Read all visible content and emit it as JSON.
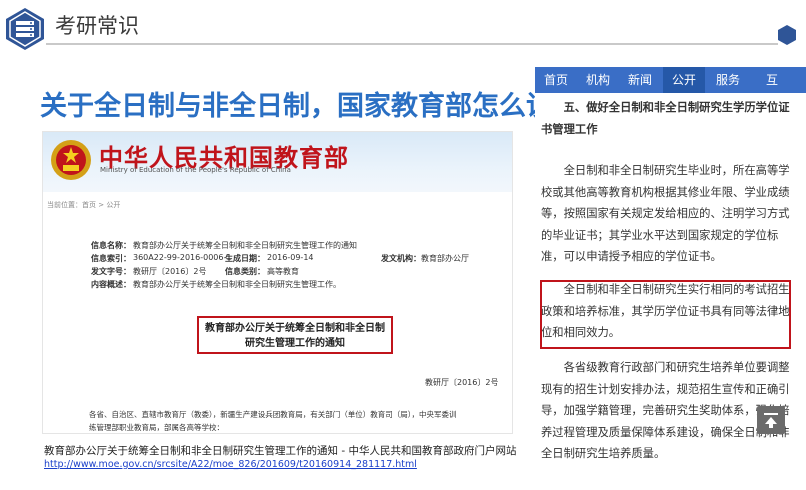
{
  "header": {
    "title": "考研常识"
  },
  "headline": "关于全日制与非全日制，国家教育部怎么说？",
  "ministry": {
    "name": "中华人民共和国教育部",
    "english_name": "Ministry of Education of the People's Republic of China",
    "breadcrumb": "当前位置：首页 > 公开",
    "info": {
      "name_label": "信息名称：",
      "name_value": "教育部办公厅关于统筹全日制和非全日制研究生管理工作的通知",
      "index_label": "信息索引：",
      "index_value": "360A22-99-2016-0006-1",
      "date_label": "生成日期：",
      "date_value": "2016-09-14",
      "issuer_label": "发文机构：",
      "issuer_value": "教育部办公厅",
      "docno_label": "发文字号：",
      "docno_value": "教研厅〔2016〕2号",
      "category_label": "信息类别：",
      "category_value": "高等教育",
      "summary_label": "内容概述：",
      "summary_value": "教育部办公厅关于统筹全日制和非全日制研究生管理工作。"
    },
    "doc_title_line1": "教育部办公厅关于统筹全日制和非全日制",
    "doc_title_line2": "研究生管理工作的通知",
    "doc_number": "教研厅〔2016〕2号",
    "body_line1": "各省、自治区、直辖市教育厅（教委），新疆生产建设兵团教育局，有关部门（单位）教育司（局），中央军委训",
    "body_line2": "练管理部职业教育局，部属各高等学校："
  },
  "caption": {
    "text": "教育部办公厅关于统筹全日制和非全日制研究生管理工作的通知 - 中华人民共和国教育部政府门户网站 ",
    "link": "http://www.moe.gov.cn/srcsite/A22/moe_826/201609/t20160914_281117.html"
  },
  "mobile": {
    "nav": [
      {
        "label": "首页"
      },
      {
        "label": "机构"
      },
      {
        "label": "新闻"
      },
      {
        "label": "公开"
      },
      {
        "label": "服务"
      },
      {
        "label": "互"
      }
    ],
    "active_nav": "公开",
    "section_heading": "五、做好全日制和非全日制研究生学历学位证书管理工作",
    "para1": "全日制和非全日制研究生毕业时，所在高等学校或其他高等教育机构根据其修业年限、学业成绩等，按照国家有关规定发给相应的、注明学习方式的毕业证书；其学业水平达到国家规定的学位标准，可以申请授予相应的学位证书。",
    "para2": "全日制和非全日制研究生实行相同的考试招生政策和培养标准，其学历学位证书具有同等法律地位和相同效力。",
    "para3": "各省级教育行政部门和研究生培养单位要调整现有的招生计划安排办法，规范招生宣传和正确引导，加强学籍管理，完善研究生奖助体系，强化培养过程管理及质量保障体系建设，确保全日制和非全日制研究生培养质量。"
  },
  "colors": {
    "headline": "#2a6fc3",
    "nav_bg": "#3a6ec6",
    "highlight": "#c0141b",
    "header_icon": "#2f5597"
  }
}
